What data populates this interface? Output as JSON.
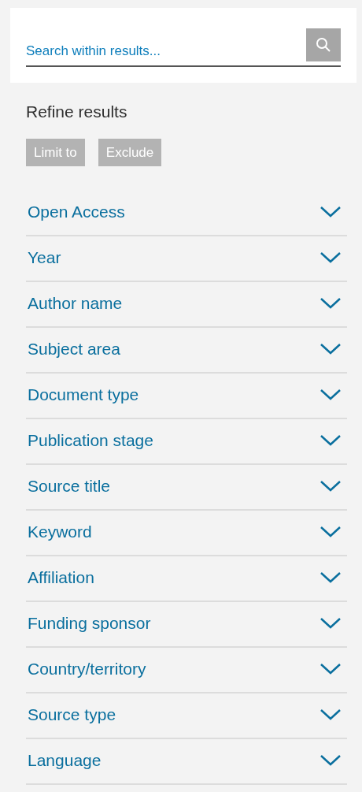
{
  "search": {
    "placeholder": "Search within results..."
  },
  "refine": {
    "title": "Refine results",
    "buttons": [
      {
        "label": "Limit to",
        "disabled": true
      },
      {
        "label": "Exclude",
        "disabled": true
      }
    ]
  },
  "facets": [
    {
      "label": "Open Access",
      "expanded": false
    },
    {
      "label": "Year",
      "expanded": false
    },
    {
      "label": "Author name",
      "expanded": false
    },
    {
      "label": "Subject area",
      "expanded": false
    },
    {
      "label": "Document type",
      "expanded": false
    },
    {
      "label": "Publication stage",
      "expanded": false
    },
    {
      "label": "Source title",
      "expanded": false
    },
    {
      "label": "Keyword",
      "expanded": false
    },
    {
      "label": "Affiliation",
      "expanded": false
    },
    {
      "label": "Funding sponsor",
      "expanded": false
    },
    {
      "label": "Country/territory",
      "expanded": false
    },
    {
      "label": "Source type",
      "expanded": false
    },
    {
      "label": "Language",
      "expanded": false
    }
  ]
}
